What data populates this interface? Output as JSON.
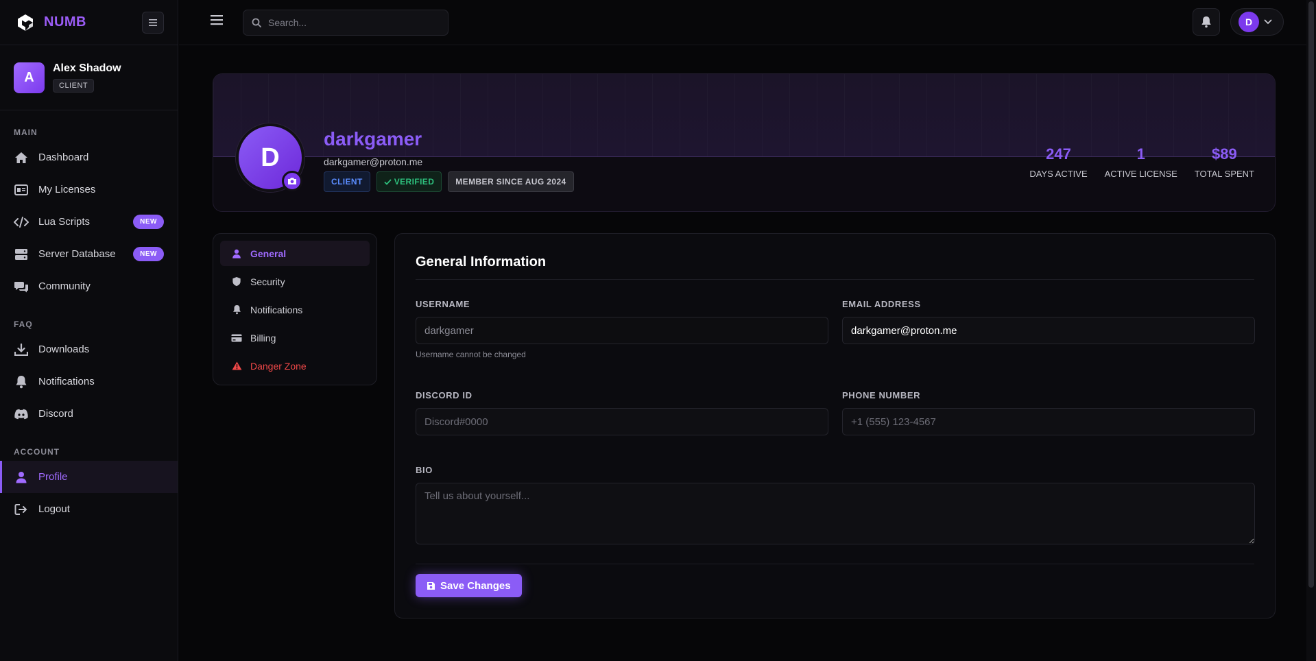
{
  "brand": {
    "name": "NUMB"
  },
  "user": {
    "name": "Alex Shadow",
    "initial": "A",
    "role": "CLIENT"
  },
  "sidebar": {
    "sections": [
      {
        "title": "MAIN",
        "items": [
          {
            "label": "Dashboard",
            "icon": "home-icon"
          },
          {
            "label": "My Licenses",
            "icon": "id-card-icon"
          },
          {
            "label": "Lua Scripts",
            "icon": "code-icon",
            "badge": "NEW"
          },
          {
            "label": "Server Database",
            "icon": "server-icon",
            "badge": "NEW"
          },
          {
            "label": "Community",
            "icon": "chat-icon"
          }
        ]
      },
      {
        "title": "FAQ",
        "items": [
          {
            "label": "Downloads",
            "icon": "download-icon"
          },
          {
            "label": "Notifications",
            "icon": "bell-icon"
          },
          {
            "label": "Discord",
            "icon": "discord-icon"
          }
        ]
      },
      {
        "title": "ACCOUNT",
        "items": [
          {
            "label": "Profile",
            "icon": "user-icon",
            "active": true
          },
          {
            "label": "Logout",
            "icon": "logout-icon"
          }
        ]
      }
    ]
  },
  "topbar": {
    "search_placeholder": "Search...",
    "avatar_initial": "D"
  },
  "profile": {
    "initial": "D",
    "username": "darkgamer",
    "email": "darkgamer@proton.me",
    "badges": {
      "client": "CLIENT",
      "verified": "VERIFIED",
      "member": "MEMBER SINCE AUG 2024"
    },
    "stats": [
      {
        "value": "247",
        "label": "DAYS ACTIVE"
      },
      {
        "value": "1",
        "label": "ACTIVE LICENSE"
      },
      {
        "value": "$89",
        "label": "TOTAL SPENT"
      }
    ]
  },
  "settings_nav": {
    "items": [
      {
        "label": "General",
        "icon": "user-icon",
        "active": true
      },
      {
        "label": "Security",
        "icon": "shield-icon"
      },
      {
        "label": "Notifications",
        "icon": "bell-icon"
      },
      {
        "label": "Billing",
        "icon": "credit-card-icon"
      },
      {
        "label": "Danger Zone",
        "icon": "warning-icon",
        "danger": true
      }
    ]
  },
  "form": {
    "title": "General Information",
    "username_label": "USERNAME",
    "username_value": "darkgamer",
    "username_help": "Username cannot be changed",
    "email_label": "EMAIL ADDRESS",
    "email_value": "darkgamer@proton.me",
    "discord_label": "DISCORD ID",
    "discord_placeholder": "Discord#0000",
    "phone_label": "PHONE NUMBER",
    "phone_placeholder": "+1 (555) 123-4567",
    "bio_label": "BIO",
    "bio_placeholder": "Tell us about yourself...",
    "save_label": "Save Changes"
  },
  "colors": {
    "accent": "#8b5cf6",
    "background": "#060608",
    "danger": "#f04848",
    "verified": "#2ec27e",
    "client_badge": "#5b8dff"
  }
}
